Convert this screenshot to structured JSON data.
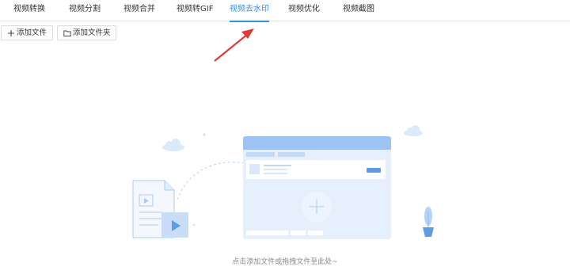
{
  "tabs": [
    {
      "label": "视频转换",
      "active": false
    },
    {
      "label": "视频分割",
      "active": false
    },
    {
      "label": "视频合并",
      "active": false
    },
    {
      "label": "视频转GIF",
      "active": false
    },
    {
      "label": "视频去水印",
      "active": true
    },
    {
      "label": "视频优化",
      "active": false
    },
    {
      "label": "视频截图",
      "active": false
    }
  ],
  "toolbar": {
    "add_file_label": "添加文件",
    "add_folder_label": "添加文件夹"
  },
  "drop_zone": {
    "hint": "点击添加文件或拖拽文件至此处~"
  },
  "icons": {
    "add_file": "plus-icon",
    "add_folder": "folder-icon",
    "annotation": "red-arrow",
    "placeholder_plus": "plus-icon",
    "video_file": "video-file-icon"
  },
  "colors": {
    "accent": "#2e8ff5",
    "annotation_arrow": "#e53935",
    "illustration_light": "#dbe9fb",
    "illustration_mid": "#a9ccf5"
  }
}
